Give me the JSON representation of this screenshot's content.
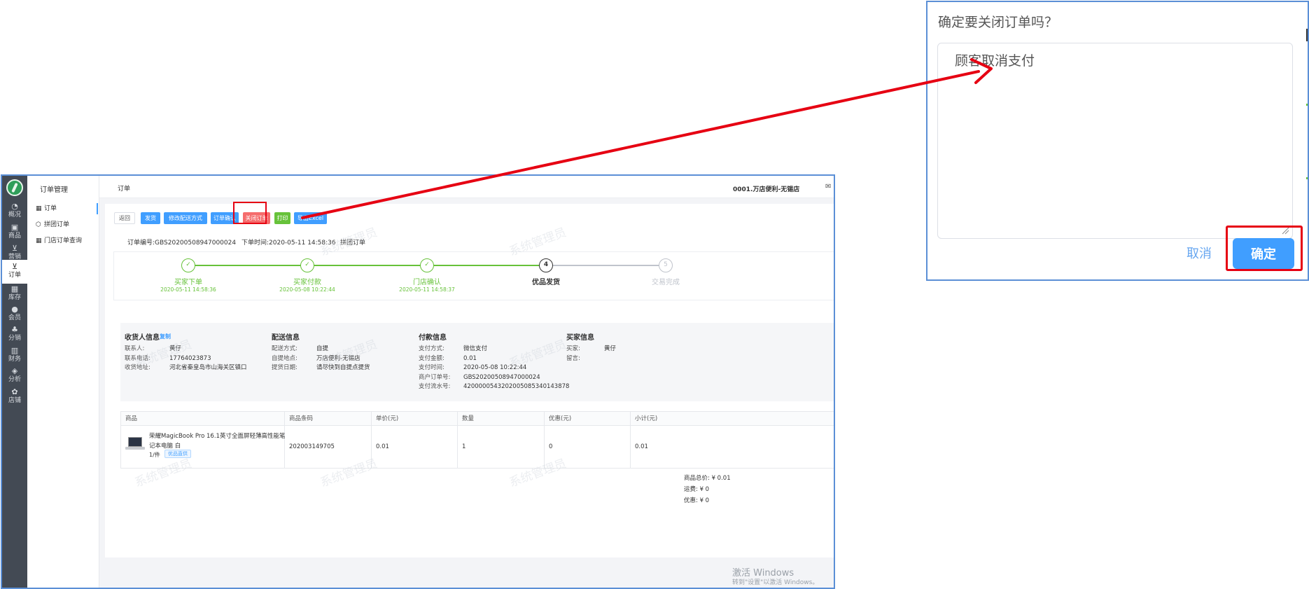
{
  "rail": {
    "items": [
      {
        "label": "概况",
        "icon": "dashboard-icon"
      },
      {
        "label": "商品",
        "icon": "product-icon"
      },
      {
        "label": "营销",
        "icon": "cart-icon"
      },
      {
        "label": "订单",
        "icon": "order-icon"
      },
      {
        "label": "库存",
        "icon": "inventory-icon"
      },
      {
        "label": "会员",
        "icon": "member-icon"
      },
      {
        "label": "分销",
        "icon": "distribution-icon"
      },
      {
        "label": "财务",
        "icon": "finance-icon"
      },
      {
        "label": "分析",
        "icon": "analysis-icon"
      },
      {
        "label": "店铺",
        "icon": "store-icon"
      }
    ]
  },
  "subnav": {
    "title": "订单管理",
    "items": [
      {
        "label": "订单"
      },
      {
        "label": "拼团订单"
      },
      {
        "label": "门店订单查询"
      }
    ]
  },
  "topbar": {
    "title": "订单",
    "store": "0001.万店便利-无锡店"
  },
  "toolbar": {
    "back": "返回",
    "ship": "发货",
    "modify_delivery": "修改配送方式",
    "confirm_order": "订单确认",
    "close_order": "关闭订单",
    "print": "打印",
    "export": "导出Excel"
  },
  "order": {
    "number": "订单编号:GBS20200508947000024",
    "time": "下单时间:2020-05-11 14:58:36",
    "type": "拼团订单"
  },
  "steps": [
    {
      "index": "1",
      "title": "买家下单",
      "time": "2020-05-11 14:58:36",
      "state": "done"
    },
    {
      "index": "2",
      "title": "买家付款",
      "time": "2020-05-08 10:22:44",
      "state": "done"
    },
    {
      "index": "3",
      "title": "门店确认",
      "time": "2020-05-11 14:58:37",
      "state": "done"
    },
    {
      "index": "4",
      "title": "优品发货",
      "time": "",
      "state": "current"
    },
    {
      "index": "5",
      "title": "交易完成",
      "time": "",
      "state": "todo"
    }
  ],
  "receiver": {
    "title": "收货人信息",
    "copy": "复制",
    "rows": [
      {
        "k": "联系人:",
        "v": "黄仔"
      },
      {
        "k": "联系电话:",
        "v": "17764023873"
      },
      {
        "k": "收货地址:",
        "v": "河北省秦皇岛市山海关区镇口"
      }
    ]
  },
  "delivery": {
    "title": "配送信息",
    "rows": [
      {
        "k": "配送方式:",
        "v": "自提"
      },
      {
        "k": "自提地点:",
        "v": "万店便利-无锡店"
      },
      {
        "k": "提货日期:",
        "v": "请尽快到自提点提货"
      }
    ]
  },
  "payment": {
    "title": "付款信息",
    "rows": [
      {
        "k": "支付方式:",
        "v": "微信支付"
      },
      {
        "k": "支付金额:",
        "v": "0.01"
      },
      {
        "k": "支付时间:",
        "v": "2020-05-08 10:22:44"
      },
      {
        "k": "商户订单号:",
        "v": "GBS20200508947000024"
      },
      {
        "k": "支付流水号:",
        "v": "4200000543202005085340143878"
      }
    ]
  },
  "buyer": {
    "title": "买家信息",
    "rows": [
      {
        "k": "买家:",
        "v": "黄仔"
      },
      {
        "k": "留言:",
        "v": ""
      }
    ]
  },
  "goods": {
    "headers": [
      "商品",
      "商品条码",
      "单价(元)",
      "数量",
      "优惠(元)",
      "小计(元)"
    ],
    "item": {
      "name": "荣耀MagicBook Pro 16.1英寸全面屏轻薄高性能笔记本电脑 白",
      "qty": "1/件",
      "tag": "优品直供",
      "barcode": "202003149705",
      "price": "0.01",
      "count": "1",
      "discount": "0",
      "subtotal": "0.01"
    }
  },
  "totals": {
    "goods_total": "商品总价: ¥ 0.01",
    "freight": "运费: ¥ 0",
    "discount": "优惠: ¥ 0"
  },
  "watermark": "系统管理员",
  "windows": {
    "activate": "激活 Windows",
    "hint": "转到\"设置\"以激活 Windows。"
  },
  "dialog": {
    "title": "确定要关闭订单吗？",
    "reason": "顾客取消支付",
    "cancel": "取消",
    "ok": "确定"
  },
  "colors": {
    "primary": "#409eff",
    "success": "#67c23a",
    "danger": "#f56c6c",
    "highlight": "#e60012",
    "rail": "#434a54"
  }
}
